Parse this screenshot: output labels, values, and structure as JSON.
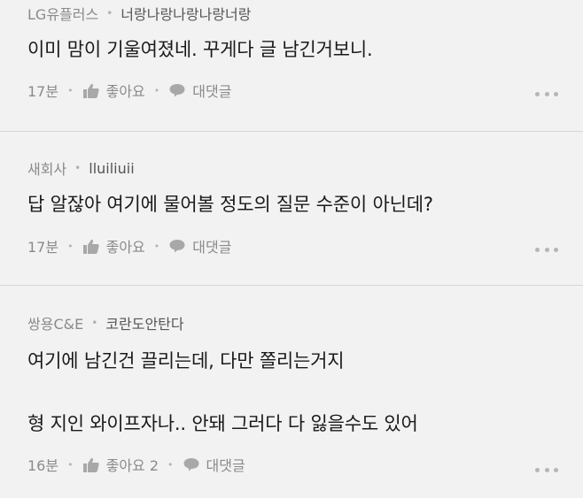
{
  "comments": [
    {
      "company": "LG유플러스",
      "nickname": "너랑나랑나랑나랑너랑",
      "lines": [
        "이미 맘이 기울여졌네. 꾸게다 글 남긴거보니."
      ],
      "time": "17분",
      "like_label": "좋아요",
      "reply_label": "대댓글"
    },
    {
      "company": "새회사",
      "nickname": "lluiliuii",
      "lines": [
        "답 알잖아 여기에 물어볼 정도의 질문 수준이 아닌데?"
      ],
      "time": "17분",
      "like_label": "좋아요",
      "reply_label": "대댓글"
    },
    {
      "company": "쌍용C&E",
      "nickname": "코란도안탄다",
      "lines": [
        "여기에 남긴건 끌리는데, 다만 쫄리는거지",
        "형 지인 와이프자나.. 안돼 그러다 다 잃을수도 있어"
      ],
      "time": "16분",
      "like_label": "좋아요 2",
      "reply_label": "대댓글"
    }
  ],
  "icons": {
    "like": "thumbs-up-icon",
    "reply": "speech-bubble-icon",
    "more": "more-dots-icon"
  },
  "colors": {
    "background": "#f2f2f2",
    "meta_text": "#8a8a8a",
    "body_text": "#1a1a1a",
    "divider": "#d6d6d6"
  }
}
